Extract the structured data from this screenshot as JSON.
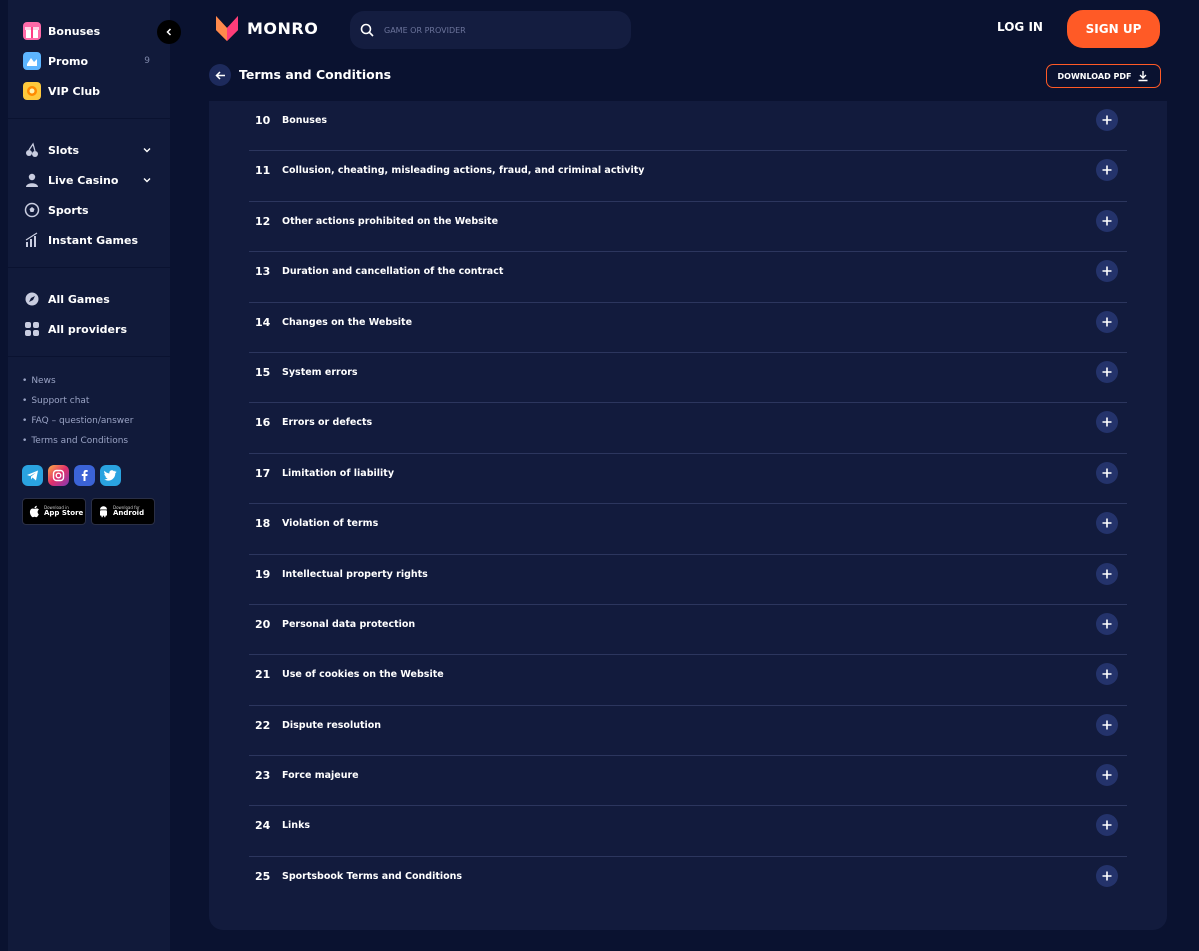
{
  "sidebar": {
    "top_items": [
      {
        "label": "Bonuses",
        "icon": "gift-icon"
      },
      {
        "label": "Promo",
        "icon": "promo-icon",
        "count": "9"
      },
      {
        "label": "VIP Club",
        "icon": "vip-icon"
      }
    ],
    "nav_items": [
      {
        "label": "Slots",
        "icon": "cherries-icon",
        "has_dropdown": true
      },
      {
        "label": "Live Casino",
        "icon": "dealer-icon",
        "has_dropdown": true
      },
      {
        "label": "Sports",
        "icon": "soccer-ball-icon"
      },
      {
        "label": "Instant Games",
        "icon": "bar-chart-icon"
      }
    ],
    "game_items": [
      {
        "label": "All Games",
        "icon": "compass-icon"
      },
      {
        "label": "All providers",
        "icon": "grid-icon"
      }
    ],
    "links": [
      "News",
      "Support chat",
      "FAQ – question/answer",
      "Terms and Conditions"
    ],
    "app_store": {
      "small": "Download in",
      "big": "App Store"
    },
    "android": {
      "small": "Download for",
      "big": "Android"
    }
  },
  "header": {
    "logo_text": "MONRO",
    "search_placeholder": "GAME OR PROVIDER",
    "login_label": "LOG IN",
    "signup_label": "SIGN UP",
    "accent_color": "#ff5a26"
  },
  "page": {
    "title": "Terms and Conditions",
    "download_label": "DOWNLOAD PDF"
  },
  "sections": [
    {
      "num": "10",
      "label": "Bonuses"
    },
    {
      "num": "11",
      "label": "Collusion, cheating, misleading actions, fraud, and criminal activity"
    },
    {
      "num": "12",
      "label": "Other actions prohibited on the Website"
    },
    {
      "num": "13",
      "label": "Duration and cancellation of the contract"
    },
    {
      "num": "14",
      "label": "Changes on the Website"
    },
    {
      "num": "15",
      "label": "System errors"
    },
    {
      "num": "16",
      "label": "Errors or defects"
    },
    {
      "num": "17",
      "label": "Limitation of liability"
    },
    {
      "num": "18",
      "label": "Violation of terms"
    },
    {
      "num": "19",
      "label": "Intellectual property rights"
    },
    {
      "num": "20",
      "label": "Personal data protection"
    },
    {
      "num": "21",
      "label": "Use of cookies on the Website"
    },
    {
      "num": "22",
      "label": "Dispute resolution"
    },
    {
      "num": "23",
      "label": "Force majeure"
    },
    {
      "num": "24",
      "label": "Links"
    },
    {
      "num": "25",
      "label": "Sportsbook Terms and Conditions"
    }
  ]
}
